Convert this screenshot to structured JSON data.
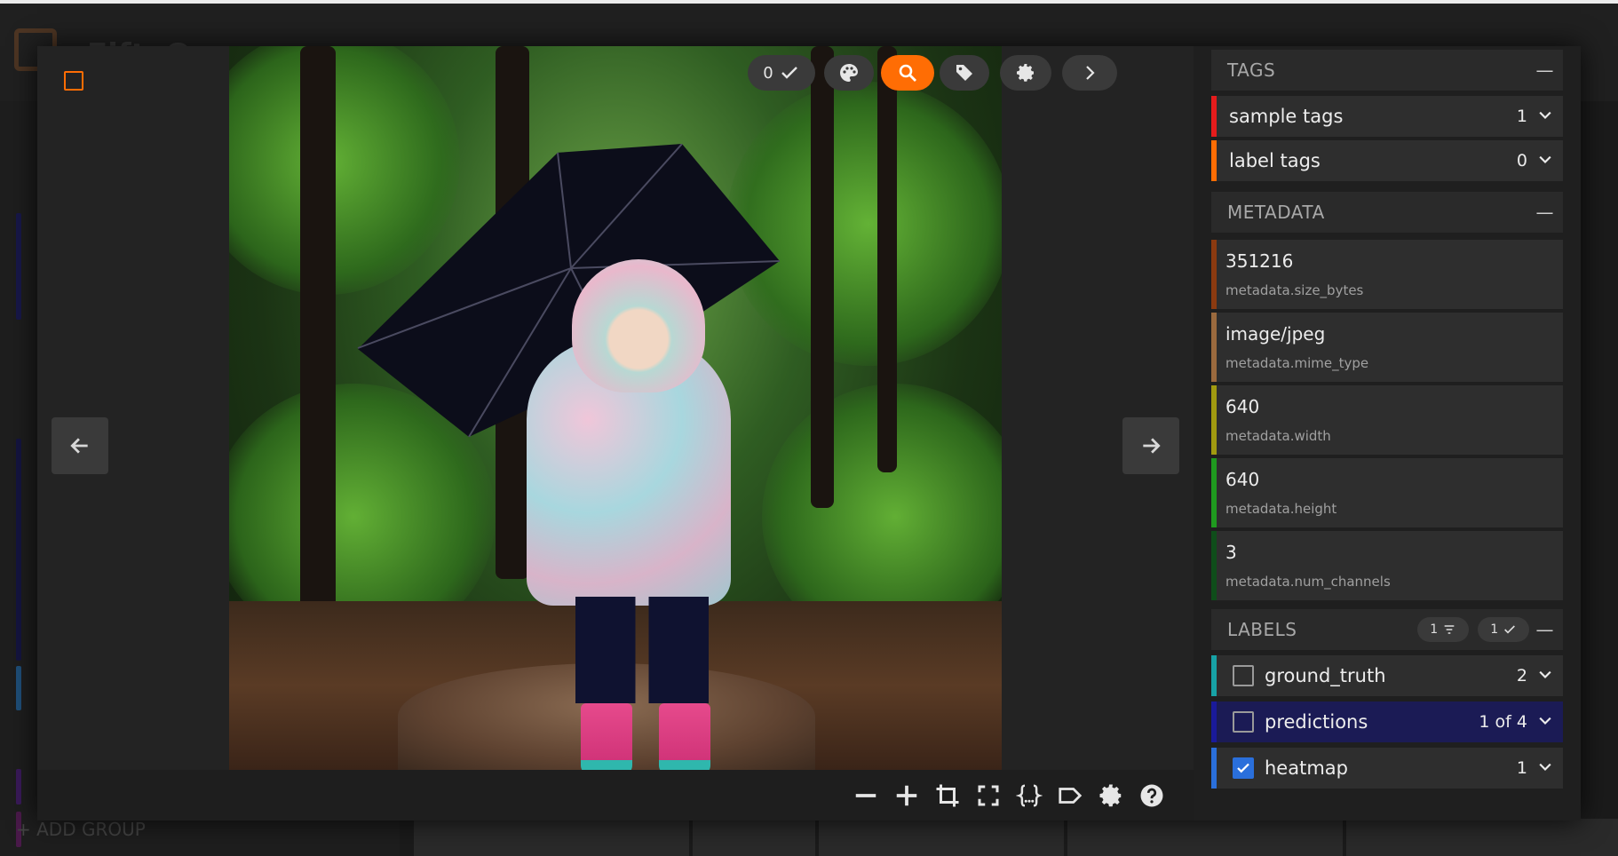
{
  "background": {
    "app_name": "FiftyOne",
    "add_group": "+ ADD GROUP"
  },
  "toolbar": {
    "selected_count": "0",
    "icons": [
      "check-icon",
      "palette-icon",
      "search-icon",
      "tag-icon",
      "gear-icon",
      "chevron-right-icon"
    ]
  },
  "bottom_tools": [
    "zoom-out-icon",
    "zoom-in-icon",
    "crop-icon",
    "fullscreen-icon",
    "json-icon",
    "label-icon",
    "gear-icon",
    "help-icon"
  ],
  "sidebar": {
    "tags": {
      "title": "TAGS",
      "collapse": "—",
      "items": [
        {
          "label": "sample tags",
          "count": "1",
          "color": "#e51c1c"
        },
        {
          "label": "label tags",
          "count": "0",
          "color": "#ff6d04"
        }
      ]
    },
    "metadata": {
      "title": "METADATA",
      "collapse": "—",
      "items": [
        {
          "value": "351216",
          "key": "metadata.size_bytes",
          "color": "#8b3a10"
        },
        {
          "value": "image/jpeg",
          "key": "metadata.mime_type",
          "color": "#9b6a3e"
        },
        {
          "value": "640",
          "key": "metadata.width",
          "color": "#a19a10"
        },
        {
          "value": "640",
          "key": "metadata.height",
          "color": "#1f9a1f"
        },
        {
          "value": "3",
          "key": "metadata.num_channels",
          "color": "#0f4d1a"
        }
      ]
    },
    "labels": {
      "title": "LABELS",
      "filter_count": "1",
      "visible_count": "1",
      "collapse": "—",
      "items": [
        {
          "label": "ground_truth",
          "count": "2",
          "color": "#17a2a6",
          "checked": false
        },
        {
          "label": "predictions",
          "count": "1 of 4",
          "color": "#1a1a9a",
          "checked": false
        },
        {
          "label": "heatmap",
          "count": "1",
          "color": "#2a6fdb",
          "checked": true
        }
      ]
    }
  },
  "colors": {
    "accent": "#ff6d04",
    "panel": "#2e2e2e"
  }
}
